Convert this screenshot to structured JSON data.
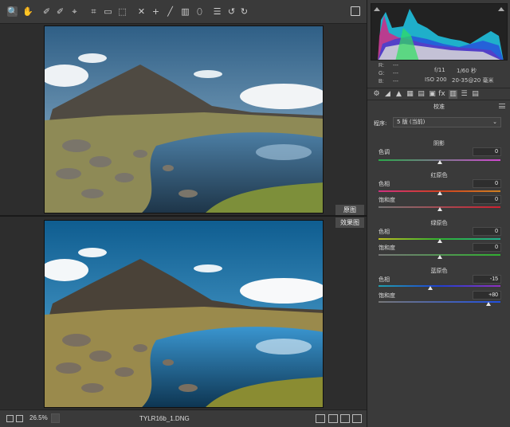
{
  "viewer": {
    "before_label": "原图",
    "after_label": "效果图"
  },
  "status": {
    "zoom": "26.5%",
    "filename": "TYLR16b_1.DNG"
  },
  "readout": {
    "r_label": "R:",
    "g_label": "G:",
    "b_label": "B:",
    "r_value": "---",
    "g_value": "---",
    "b_value": "---",
    "aperture": "f/11",
    "shutter": "1/60 秒",
    "iso": "ISO 200",
    "lens": "20-35@20 毫米"
  },
  "panel": {
    "section_title": "校准",
    "process_label": "程序:",
    "process_value": "5 版 (当前)",
    "shadows": {
      "title": "阴影",
      "tint_label": "色调",
      "tint_value": "0",
      "tint_level": 0
    },
    "red": {
      "title": "红原色",
      "hue_label": "色相",
      "hue_value": "0",
      "hue_level": 0,
      "sat_label": "饱和度",
      "sat_value": "0",
      "sat_level": 0
    },
    "green": {
      "title": "绿原色",
      "hue_label": "色相",
      "hue_value": "0",
      "hue_level": 0,
      "sat_label": "饱和度",
      "sat_value": "0",
      "sat_level": 0
    },
    "blue": {
      "title": "蓝原色",
      "hue_label": "色相",
      "hue_value": "-15",
      "hue_level": -15,
      "sat_label": "饱和度",
      "sat_value": "+80",
      "sat_level": 80
    }
  },
  "toolbar_icons": [
    "zoom-icon",
    "hand-icon",
    "white-balance-icon",
    "color-sampler-icon",
    "target-adjust-icon",
    "crop-icon",
    "straighten-icon",
    "transform-icon",
    "spot-removal-icon",
    "red-eye-icon",
    "adjustment-brush-icon",
    "graduated-filter-icon",
    "radial-filter-icon",
    "preferences-icon",
    "rotate-left-icon",
    "rotate-right-icon"
  ],
  "colors": {
    "accent_track_red": "#c0303a",
    "accent_track_green": "#3a9a3a",
    "accent_track_blue": "#3050c0"
  }
}
